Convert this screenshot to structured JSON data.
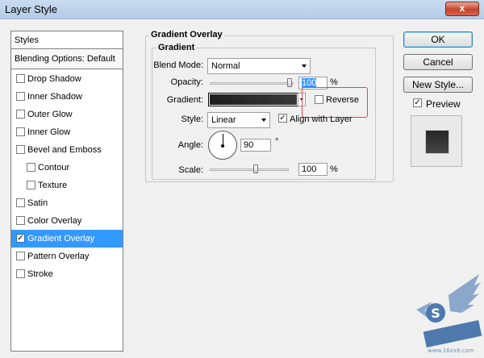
{
  "window": {
    "title": "Layer Style",
    "close_label": "x"
  },
  "styles_panel": {
    "header": "Styles",
    "blending_options": "Blending Options: Default",
    "items": [
      {
        "label": "Drop Shadow",
        "checked": false,
        "sub": false,
        "selected": false
      },
      {
        "label": "Inner Shadow",
        "checked": false,
        "sub": false,
        "selected": false
      },
      {
        "label": "Outer Glow",
        "checked": false,
        "sub": false,
        "selected": false
      },
      {
        "label": "Inner Glow",
        "checked": false,
        "sub": false,
        "selected": false
      },
      {
        "label": "Bevel and Emboss",
        "checked": false,
        "sub": false,
        "selected": false
      },
      {
        "label": "Contour",
        "checked": false,
        "sub": true,
        "selected": false
      },
      {
        "label": "Texture",
        "checked": false,
        "sub": true,
        "selected": false
      },
      {
        "label": "Satin",
        "checked": false,
        "sub": false,
        "selected": false
      },
      {
        "label": "Color Overlay",
        "checked": false,
        "sub": false,
        "selected": false
      },
      {
        "label": "Gradient Overlay",
        "checked": true,
        "sub": false,
        "selected": true
      },
      {
        "label": "Pattern Overlay",
        "checked": false,
        "sub": false,
        "selected": false
      },
      {
        "label": "Stroke",
        "checked": false,
        "sub": false,
        "selected": false
      }
    ]
  },
  "gradient_overlay": {
    "group_title": "Gradient Overlay",
    "subgroup_title": "Gradient",
    "blend_mode_label": "Blend Mode:",
    "blend_mode_value": "Normal",
    "opacity_label": "Opacity:",
    "opacity_value": "100",
    "opacity_fraction": 1.0,
    "opacity_unit": "%",
    "gradient_label": "Gradient:",
    "reverse_label": "Reverse",
    "reverse_checked": false,
    "style_label": "Style:",
    "style_value": "Linear",
    "align_label": "Align with Layer",
    "align_checked": true,
    "angle_label": "Angle:",
    "angle_value": "90",
    "angle_unit": "°",
    "scale_label": "Scale:",
    "scale_value": "100",
    "scale_fraction": 0.6,
    "scale_unit": "%"
  },
  "buttons": {
    "ok": "OK",
    "cancel": "Cancel",
    "new_style": "New Style...",
    "preview_label": "Preview",
    "preview_checked": true
  },
  "colors": {
    "selection": "#3399ff",
    "highlight_border": "#e0454a",
    "gradient_start": "#1e1e1e",
    "gradient_end": "#3a3a3a"
  }
}
